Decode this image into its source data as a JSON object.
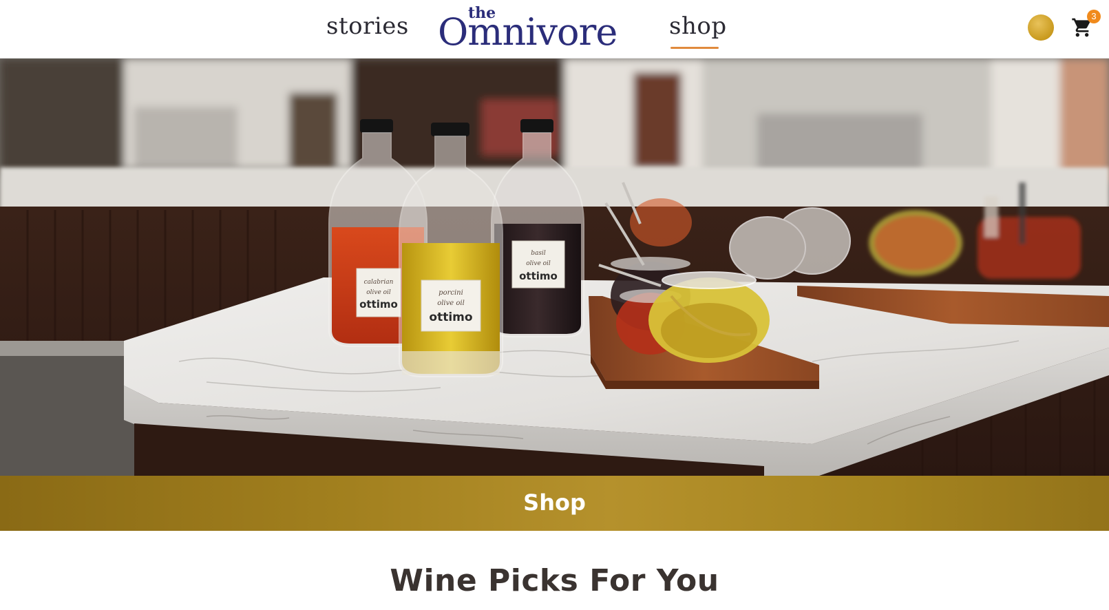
{
  "header": {
    "nav": {
      "stories_label": "stories",
      "shop_label": "shop"
    },
    "logo": {
      "small": "the",
      "main": "Omnivore"
    },
    "cart": {
      "count": "3"
    }
  },
  "hero": {
    "bottles": [
      {
        "label_line1": "calabrian",
        "label_line2": "olive oil",
        "brand": "ottimo"
      },
      {
        "label_line1": "porcini",
        "label_line2": "olive oil",
        "brand": "ottimo"
      },
      {
        "label_line1": "basil",
        "label_line2": "olive oil",
        "brand": "ottimo"
      }
    ]
  },
  "band": {
    "title": "Shop"
  },
  "section": {
    "title": "Wine Picks For You"
  },
  "colors": {
    "brand_navy": "#2b2d7a",
    "accent_orange": "#e08a3c",
    "band_gold": "#a17f1e",
    "badge_orange": "#f08a1c"
  }
}
